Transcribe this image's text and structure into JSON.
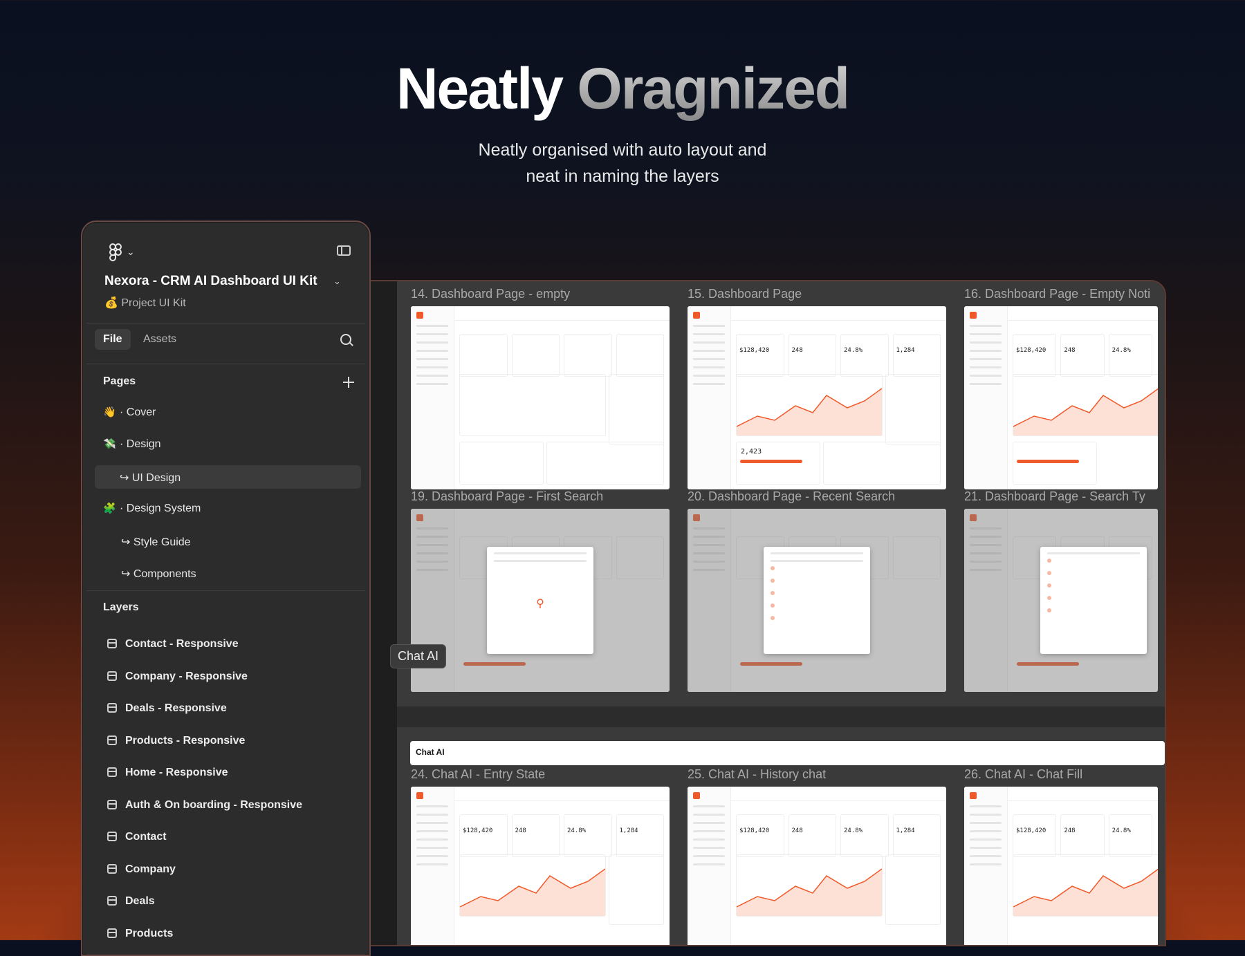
{
  "hero": {
    "title_part1": "Neatly",
    "title_part2": "Oragnized",
    "subtitle_line1": "Neatly organised with auto layout and",
    "subtitle_line2": "neat in naming the layers"
  },
  "panel": {
    "project_title": "Nexora - CRM AI Dashboard UI Kit",
    "project_subtitle": "💰 Project UI Kit",
    "tabs": {
      "file": "File",
      "assets": "Assets"
    },
    "pages_title": "Pages",
    "pages": [
      {
        "emoji": "👋",
        "label": "· Cover"
      },
      {
        "emoji": "💸",
        "label": "· Design"
      },
      {
        "emoji": "",
        "label": "↪ UI Design"
      },
      {
        "emoji": "🧩",
        "label": "· Design System"
      },
      {
        "emoji": "",
        "label": "↪ Style Guide"
      },
      {
        "emoji": "",
        "label": "↪ Components"
      }
    ],
    "layers_title": "Layers",
    "layers": [
      "Contact - Responsive",
      "Company - Responsive",
      "Deals - Responsive",
      "Products - Responsive",
      "Home - Responsive",
      "Auth & On boarding - Responsive",
      "Contact",
      "Company",
      "Deals",
      "Products"
    ]
  },
  "canvas": {
    "frames": [
      "14. Dashboard Page - empty",
      "15. Dashboard Page",
      "16. Dashboard Page - Empty Noti",
      "19. Dashboard Page  - First Search",
      "20. Dashboard Page  - Recent Search",
      "21. Dashboard Page  - Search Ty",
      "24. Chat AI - Entry State",
      "25. Chat AI - History chat",
      "26. Chat AI - Chat Fill"
    ],
    "section_label": "Chat AI",
    "chat_bar_label": "Chat AI",
    "kpis": [
      "$128,420",
      "248",
      "24.8%",
      "1,284"
    ],
    "kpi_secondary": "2,423"
  }
}
